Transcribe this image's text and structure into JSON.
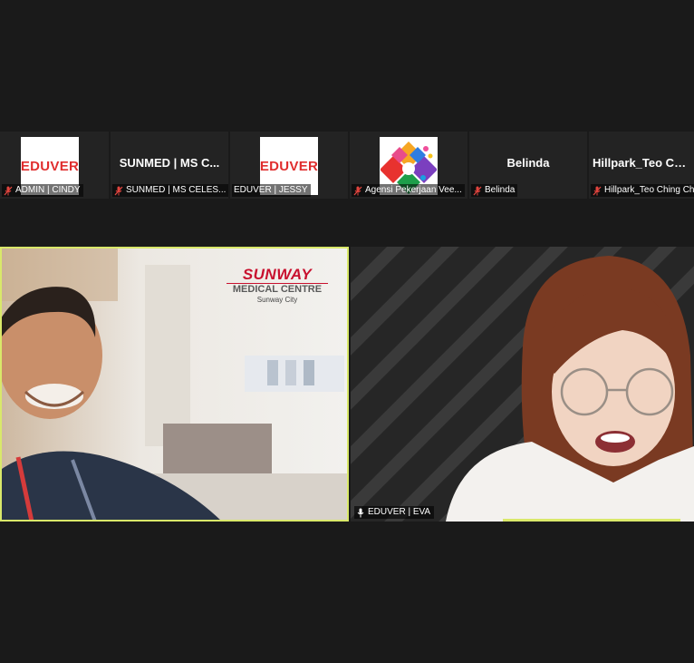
{
  "participants_strip": [
    {
      "display": "EDUVER",
      "label": "ADMIN | CINDY",
      "muted": true,
      "type": "logo"
    },
    {
      "display": "SUNMED | MS C...",
      "label": "SUNMED | MS CELES...",
      "muted": true,
      "type": "name"
    },
    {
      "display": "EDUVER",
      "label": "EDUVER | JESSY",
      "muted": false,
      "type": "logo"
    },
    {
      "display": "",
      "label": "Agensi Pekerjaan Vee...",
      "muted": true,
      "type": "colorful-logo"
    },
    {
      "display": "Belinda",
      "label": "Belinda",
      "muted": true,
      "type": "name"
    },
    {
      "display": "Hillpark_Teo  Chi...",
      "label": "Hillpark_Teo Ching Ch",
      "muted": true,
      "type": "name"
    }
  ],
  "main_videos": {
    "left": {
      "branding": {
        "line1": "SUNWAY",
        "line2": "MEDICAL CENTRE",
        "line3": "Sunway City"
      },
      "highlight_color": "#d9e86a"
    },
    "right": {
      "name_label": "EDUVER | EVA",
      "active_speaker_color": "#d9e86a"
    }
  },
  "colors": {
    "background": "#1a1a1a",
    "tile": "#232323",
    "muted_icon": "#e0443e",
    "eduver_red": "#e02e2e"
  }
}
